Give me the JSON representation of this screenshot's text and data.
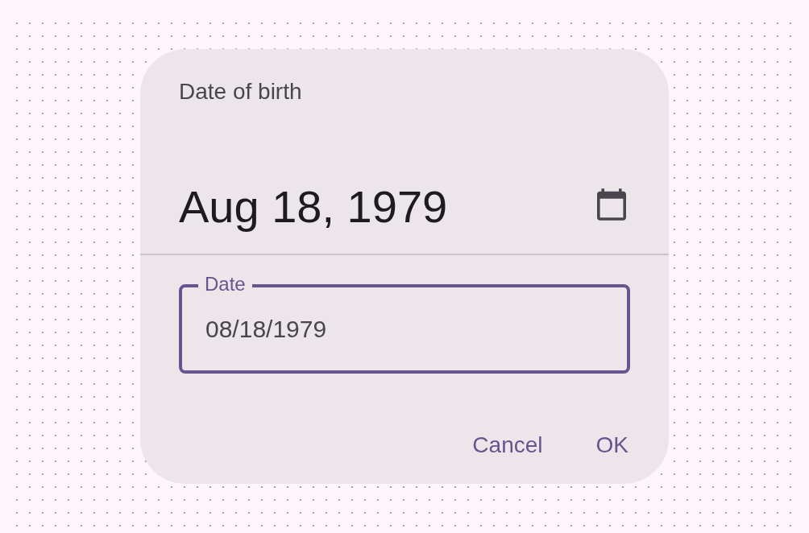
{
  "dialog": {
    "title": "Date of birth",
    "headline": "Aug 18, 1979",
    "date_field": {
      "label": "Date",
      "value": "08/18/1979",
      "focused": true
    },
    "buttons": [
      "Cancel",
      "OK"
    ]
  }
}
